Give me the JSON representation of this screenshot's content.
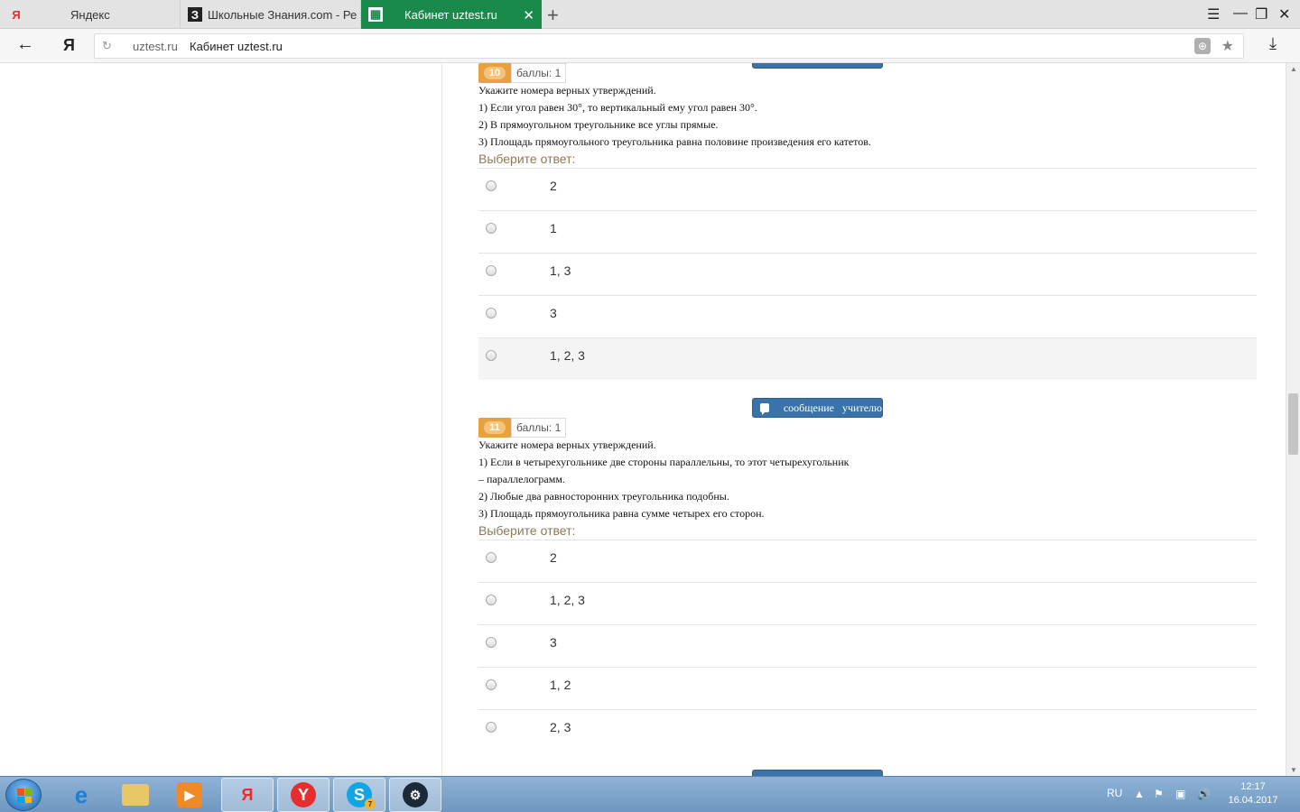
{
  "browser": {
    "tabs": [
      {
        "label": "Яндекс",
        "favicon": "Я",
        "active": false
      },
      {
        "label": "Школьные Знания.com - Ре",
        "favicon": "З",
        "active": false
      },
      {
        "label": "Кабинет uztest.ru",
        "favicon": "▦",
        "active": true
      }
    ],
    "new_tab": "+",
    "logo": "Я",
    "address": {
      "domain": "uztest.ru",
      "title": "Кабинет uztest.ru"
    },
    "accent_color": "#1a8a4a"
  },
  "questions": [
    {
      "number": "10",
      "points": "баллы: 1",
      "lines": [
        "Укажите номера верных утверждений.",
        "1) Если угол равен 30°, то вертикальный ему угол равен 30°.",
        "2) В прямоугольном треугольнике все углы прямые.",
        "3) Площадь прямоугольного треугольника равна половине произведения его катетов."
      ],
      "prompt": "Выберите ответ:",
      "options": [
        "2",
        "1",
        "1, 3",
        "3",
        "1, 2, 3"
      ]
    },
    {
      "number": "11",
      "points": "баллы: 1",
      "lines": [
        "Укажите номера верных утверждений.",
        "1) Если в четырехугольнике две стороны параллельны, то этот четырехугольник",
        "– параллелограмм.",
        "2) Любые два равносторонних треугольника подобны.",
        "3) Площадь прямоугольника равна сумме четырех его сторон."
      ],
      "prompt": "Выберите ответ:",
      "options": [
        "2",
        "1, 2, 3",
        "3",
        "1, 2",
        "2, 3"
      ]
    }
  ],
  "message_button": {
    "label": "сообщение   учителю"
  },
  "taskbar": {
    "apps": [
      "internet-explorer",
      "file-explorer",
      "media-player",
      "yandex-browser",
      "yandex",
      "skype",
      "steam"
    ],
    "skype_badge": "7",
    "tray_lang": "RU",
    "time": "12:17",
    "date": "16.04.2017"
  }
}
